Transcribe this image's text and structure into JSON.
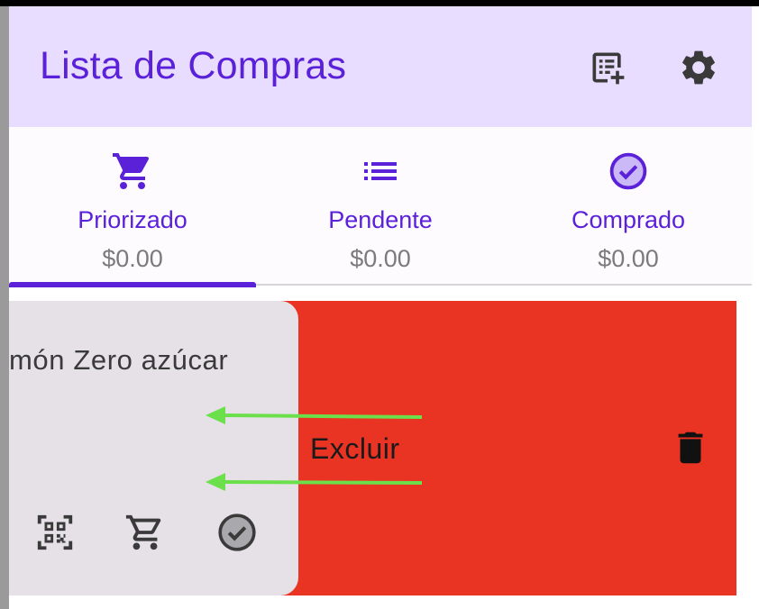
{
  "app_bar": {
    "title": "Lista de Compras",
    "icons": [
      "add-list-icon",
      "settings-icon"
    ],
    "background": "#e9ddff",
    "accent": "#5b21d9"
  },
  "tabs": [
    {
      "label": "Priorizado",
      "amount": "$0.00",
      "icon": "cart-icon",
      "selected": true
    },
    {
      "label": "Pendente",
      "amount": "$0.00",
      "icon": "list-icon",
      "selected": false
    },
    {
      "label": "Comprado",
      "amount": "$0.00",
      "icon": "check-circle-icon",
      "selected": false
    }
  ],
  "item": {
    "title": "món Zero azúcar",
    "actions": [
      "qr-code-icon",
      "cart-icon",
      "check-circle-icon"
    ],
    "swipe_action": {
      "label": "Excluir",
      "icon": "trash-icon",
      "color": "#e93323"
    }
  },
  "annotation": {
    "arrow_color": "#6be04a"
  }
}
